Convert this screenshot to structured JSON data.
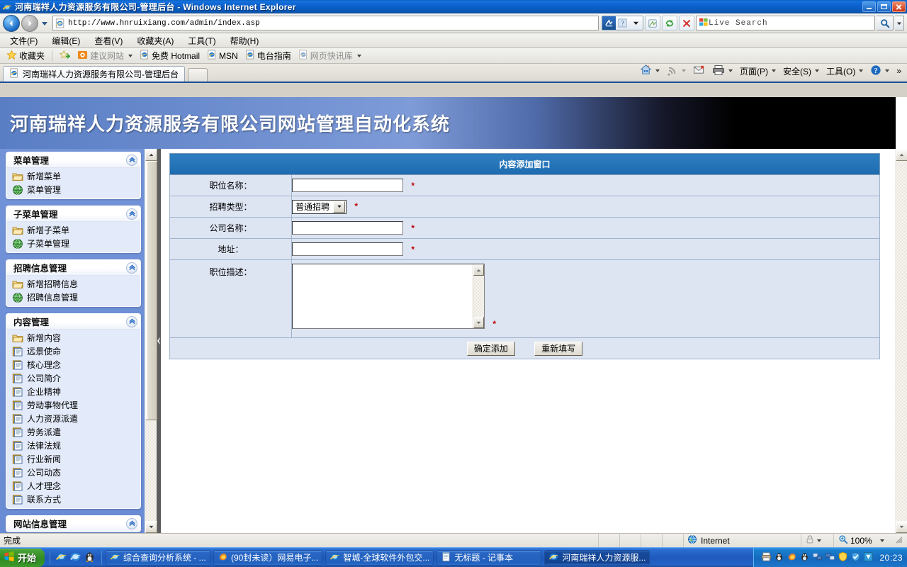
{
  "window": {
    "title": "河南瑞祥人力资源服务有限公司-管理后台  -  Windows Internet Explorer",
    "minimize_label": "最小化",
    "maximize_label": "最大化",
    "close_label": "关闭"
  },
  "address_bar": {
    "back_label": "后退",
    "forward_label": "前进",
    "recent_label": "最近访问的页面",
    "url": "http://www.hnruixiang.com/admin/index.asp",
    "compat_label": "兼容性视图",
    "compat_help_label": "帮助",
    "feeds_label": "源",
    "refresh_label": "刷新",
    "stop_label": "停止",
    "search_value": "Live Search",
    "search_go_label": "搜索",
    "search_options_label": "搜索选项"
  },
  "menu": {
    "items": [
      {
        "label": "文件(F)"
      },
      {
        "label": "编辑(E)"
      },
      {
        "label": "查看(V)"
      },
      {
        "label": "收藏夹(A)"
      },
      {
        "label": "工具(T)"
      },
      {
        "label": "帮助(H)"
      }
    ]
  },
  "favorites_bar": {
    "favorites_label": "收藏夹",
    "add_label": "添加到收藏夹栏",
    "items": [
      {
        "label": "建议网站",
        "icon": "suggested-sites-icon",
        "dim": true,
        "caret": true
      },
      {
        "label": "免费 Hotmail",
        "icon": "ie-page-icon",
        "dim": false,
        "caret": false
      },
      {
        "label": "MSN",
        "icon": "ie-page-icon",
        "dim": false,
        "caret": false
      },
      {
        "label": "电台指南",
        "icon": "ie-page-icon",
        "dim": false,
        "caret": false
      },
      {
        "label": "网页快讯库",
        "icon": "ie-page-icon",
        "dim": true,
        "caret": true
      }
    ]
  },
  "tabs": {
    "active_tab_label": "河南瑞祥人力资源服务有限公司-管理后台",
    "new_tab_label": "新选项卡"
  },
  "command_bar": {
    "items": [
      {
        "label": "",
        "icon": "home-icon",
        "caret": true
      },
      {
        "label": "",
        "icon": "feeds-icon",
        "caret": true
      },
      {
        "label": "",
        "icon": "mail-icon",
        "caret": false
      },
      {
        "label": "",
        "icon": "print-icon",
        "caret": true
      },
      {
        "label": "页面(P)",
        "icon": "",
        "caret": true
      },
      {
        "label": "安全(S)",
        "icon": "",
        "caret": true
      },
      {
        "label": "工具(O)",
        "icon": "",
        "caret": true
      },
      {
        "label": "",
        "icon": "help-icon",
        "caret": true
      },
      {
        "label": "»",
        "icon": "",
        "caret": false
      }
    ]
  },
  "banner": {
    "title": "河南瑞祥人力资源服务有限公司网站管理自动化系统"
  },
  "sidebar": {
    "collapse_icon": "chevron-up-icon",
    "splitter_label": "折叠面板",
    "groups": [
      {
        "title": "菜单管理",
        "items": [
          {
            "label": "新增菜单",
            "icon": "folder-icon"
          },
          {
            "label": "菜单管理",
            "icon": "globe-icon"
          }
        ]
      },
      {
        "title": "子菜单管理",
        "items": [
          {
            "label": "新增子菜单",
            "icon": "folder-icon"
          },
          {
            "label": "子菜单管理",
            "icon": "globe-icon"
          }
        ]
      },
      {
        "title": "招聘信息管理",
        "items": [
          {
            "label": "新增招聘信息",
            "icon": "folder-icon"
          },
          {
            "label": "招聘信息管理",
            "icon": "globe-icon"
          }
        ]
      },
      {
        "title": "内容管理",
        "items": [
          {
            "label": "新增内容",
            "icon": "folder-icon"
          },
          {
            "label": "远景使命",
            "icon": "page-icon"
          },
          {
            "label": "核心理念",
            "icon": "page-icon"
          },
          {
            "label": "公司简介",
            "icon": "page-icon"
          },
          {
            "label": "企业精神",
            "icon": "page-icon"
          },
          {
            "label": "劳动事物代理",
            "icon": "page-icon"
          },
          {
            "label": "人力资源派遣",
            "icon": "page-icon"
          },
          {
            "label": "劳务派遣",
            "icon": "page-icon"
          },
          {
            "label": "法律法规",
            "icon": "page-icon"
          },
          {
            "label": "行业新闻",
            "icon": "page-icon"
          },
          {
            "label": "公司动态",
            "icon": "page-icon"
          },
          {
            "label": "人才理念",
            "icon": "page-icon"
          },
          {
            "label": "联系方式",
            "icon": "page-icon"
          }
        ]
      },
      {
        "title": "网站信息管理",
        "items": []
      }
    ]
  },
  "form": {
    "panel_title": "内容添加窗口",
    "required_mark": "*",
    "rows": [
      {
        "label": "职位名称：",
        "type": "text",
        "value": "",
        "required": true
      },
      {
        "label": "招聘类型：",
        "type": "select",
        "value": "普通招聘",
        "required": true
      },
      {
        "label": "公司名称：",
        "type": "text",
        "value": "",
        "required": true
      },
      {
        "label": "地址：",
        "type": "text",
        "value": "",
        "required": true
      },
      {
        "label": "职位描述：",
        "type": "textarea",
        "value": "",
        "required": true
      }
    ],
    "submit_label": "确定添加",
    "reset_label": "重新填写"
  },
  "status_bar": {
    "message": "完成",
    "zone": "Internet",
    "zone_icon": "globe-icon",
    "protected_icon": "lock-icon",
    "zoom_icon": "zoom-icon",
    "zoom_level": "100%"
  },
  "taskbar": {
    "start_label": "开始",
    "quick_launch": [
      {
        "name": "ie-icon"
      },
      {
        "name": "ie-icon2"
      },
      {
        "name": "qq-penguin-icon"
      }
    ],
    "tasks": [
      {
        "label": "综合查询分析系统  -  ...",
        "icon": "ie-icon",
        "active": false
      },
      {
        "label": "(90封未读）网易电子...",
        "icon": "firefox-icon",
        "active": false
      },
      {
        "label": "智城-全球软件外包交...",
        "icon": "ie-icon",
        "active": false
      },
      {
        "label": "无标题 - 记事本",
        "icon": "notepad-icon",
        "active": false
      },
      {
        "label": "河南瑞祥人力资源服...",
        "icon": "ie-icon",
        "active": true
      }
    ],
    "tray_icons": [
      "printer-icon",
      "qq-icon",
      "firefox-tray-icon",
      "qq2-icon",
      "net1-icon",
      "net2-icon",
      "shield-icon",
      "antivirus-icon",
      "defender-icon"
    ],
    "clock": "20:23"
  },
  "colors": {
    "title_blue": "#0d62cf",
    "banner_blue": "#6f8fd0",
    "panel_header": "#2f7ec0",
    "sidebar_blue": "#7293d8",
    "required_red": "#c00000",
    "taskbar_blue": "#2160bd",
    "start_green": "#2f8a22"
  }
}
